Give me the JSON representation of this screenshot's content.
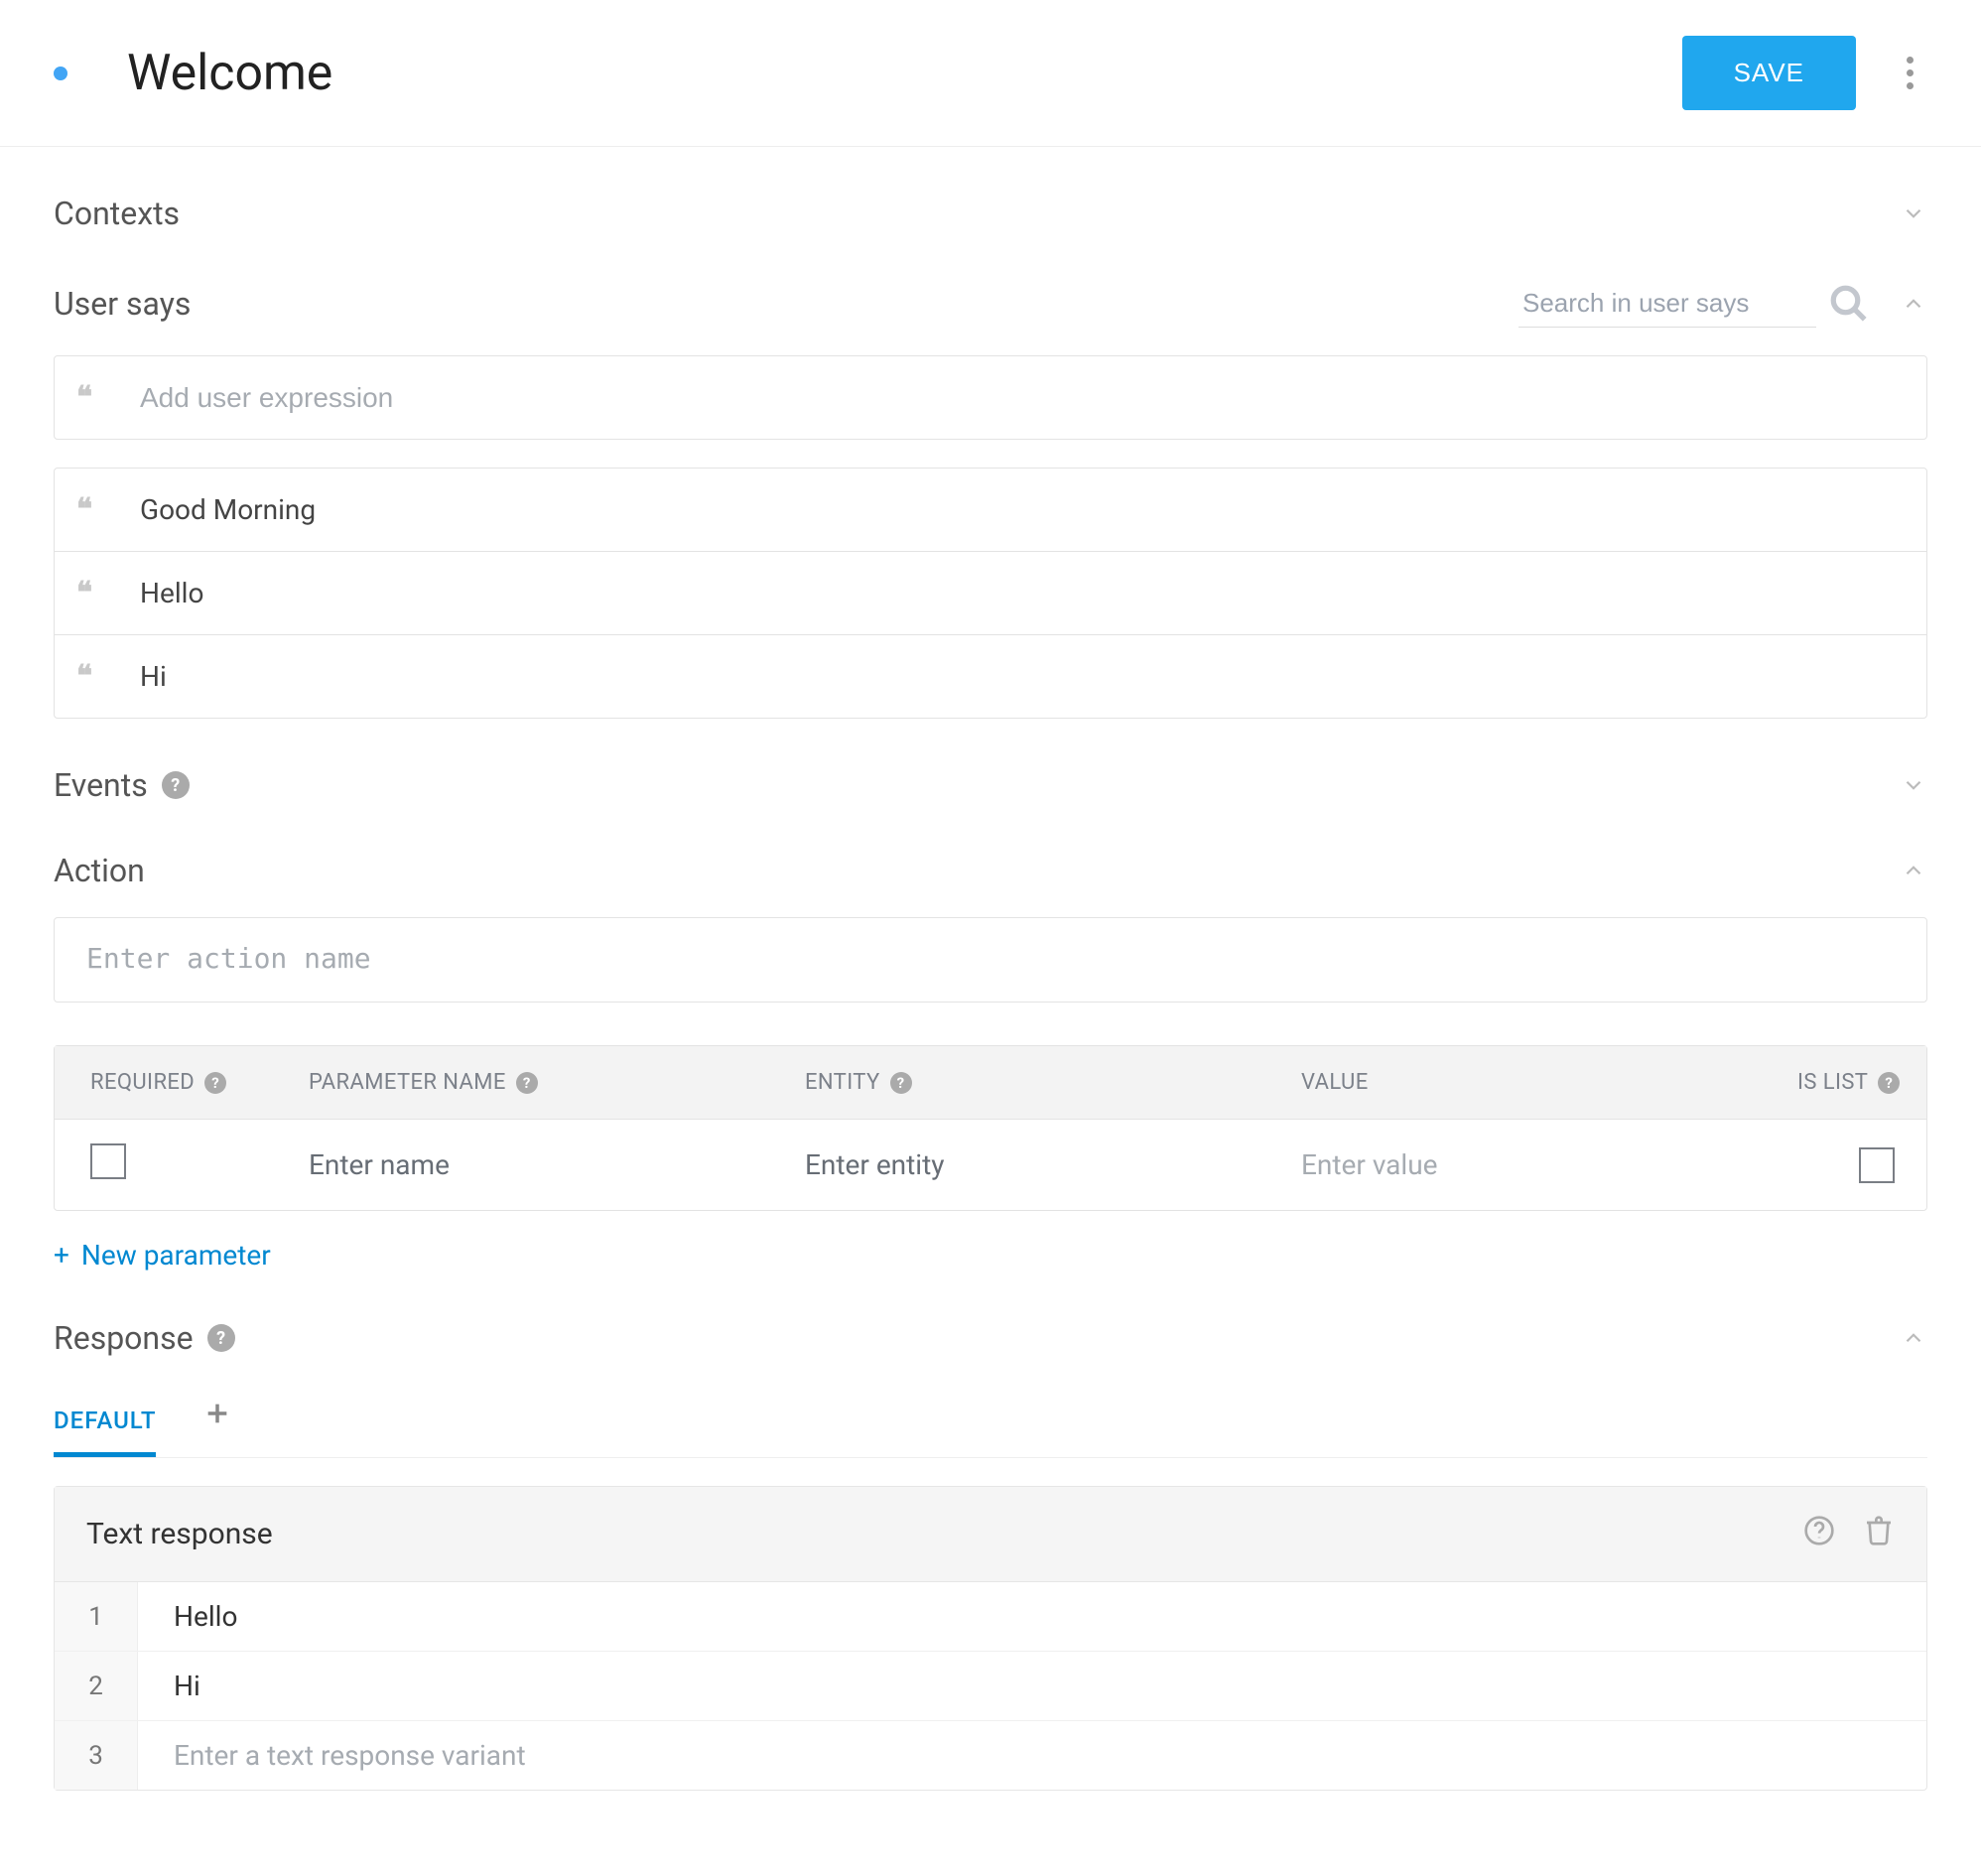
{
  "header": {
    "title": "Welcome",
    "save_label": "SAVE"
  },
  "contexts": {
    "title": "Contexts"
  },
  "user_says": {
    "title": "User says",
    "search_placeholder": "Search in user says",
    "add_placeholder": "Add user expression",
    "items": [
      "Good Morning",
      "Hello",
      "Hi"
    ]
  },
  "events": {
    "title": "Events"
  },
  "action": {
    "title": "Action",
    "name_placeholder": "Enter action name",
    "columns": {
      "required": "REQUIRED",
      "parameter_name": "PARAMETER NAME",
      "entity": "ENTITY",
      "value": "VALUE",
      "is_list": "IS LIST"
    },
    "row_placeholders": {
      "name": "Enter name",
      "entity": "Enter entity",
      "value": "Enter value"
    },
    "new_parameter_label": "New parameter"
  },
  "response": {
    "title": "Response",
    "tabs": [
      "DEFAULT"
    ],
    "card_title": "Text response",
    "rows": [
      {
        "n": "1",
        "text": "Hello",
        "placeholder": false
      },
      {
        "n": "2",
        "text": "Hi",
        "placeholder": false
      },
      {
        "n": "3",
        "text": "Enter a text response variant",
        "placeholder": true
      }
    ]
  }
}
